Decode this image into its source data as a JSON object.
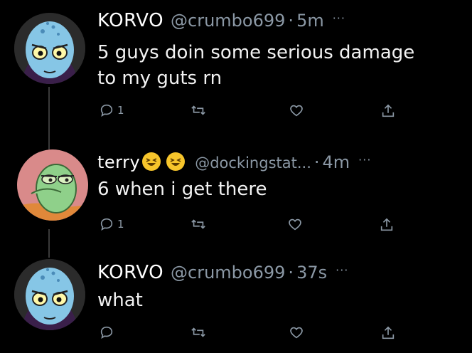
{
  "tweets": [
    {
      "name": "KORVO",
      "handle": "@crumbo699",
      "separator": "·",
      "time": "5m",
      "more": "···",
      "text_lines": [
        "5 guys doin some serious damage",
        "to my guts rn"
      ],
      "reply_count": "1",
      "avatar": "korvo-alien-avatar"
    },
    {
      "name": "terry",
      "handle": "@dockingstat...",
      "separator": "·",
      "time": "4m",
      "more": "···",
      "text_lines": [
        "6 when i get there"
      ],
      "reply_count": "1",
      "avatar": "terry-alien-avatar",
      "name_emojis": [
        "laughing-emoji",
        "laughing-emoji"
      ]
    },
    {
      "name": "KORVO",
      "handle": "@crumbo699",
      "separator": "·",
      "time": "37s",
      "more": "···",
      "text_lines": [
        "what"
      ],
      "reply_count": "",
      "avatar": "korvo-alien-avatar"
    }
  ],
  "icons": {
    "reply": "reply-icon",
    "retweet": "retweet-icon",
    "like": "like-icon",
    "share": "share-icon"
  },
  "colors": {
    "background": "#000000",
    "text": "#e7e9ea",
    "muted": "#8b98a5",
    "thread_line": "#3a3a3a"
  }
}
